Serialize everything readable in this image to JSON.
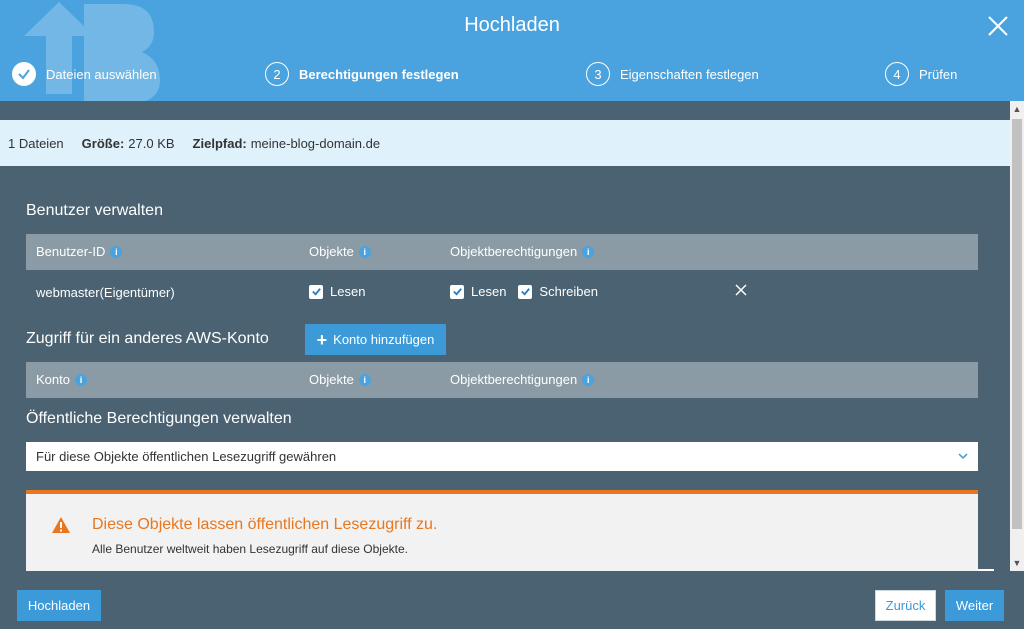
{
  "header": {
    "title": "Hochladen",
    "bg_color": "#4aa3de",
    "steps": [
      {
        "num": "",
        "label": "Dateien auswählen",
        "state": "done"
      },
      {
        "num": "2",
        "label": "Berechtigungen festlegen",
        "state": "active"
      },
      {
        "num": "3",
        "label": "Eigenschaften festlegen",
        "state": "pending"
      },
      {
        "num": "4",
        "label": "Prüfen",
        "state": "pending"
      }
    ]
  },
  "infobar": {
    "files": "1 Dateien",
    "size_label": "Größe:",
    "size_value": "27.0 KB",
    "target_label": "Zielpfad:",
    "target_value": "meine-blog-domain.de"
  },
  "users": {
    "title": "Benutzer verwalten",
    "headers": [
      "Benutzer-ID",
      "Objekte",
      "Objektberechtigungen"
    ],
    "row": {
      "user": "webmaster(Eigentümer)",
      "objects_read": "Lesen",
      "perm_read": "Lesen",
      "perm_write": "Schreiben"
    }
  },
  "aws": {
    "title": "Zugriff für ein anderes AWS-Konto",
    "add_button": "Konto hinzufügen",
    "headers": [
      "Konto",
      "Objekte",
      "Objektberechtigungen"
    ]
  },
  "public": {
    "title": "Öffentliche Berechtigungen verwalten",
    "select_value": "Für diese Objekte öffentlichen Lesezugriff gewähren"
  },
  "warning": {
    "title": "Diese Objekte lassen öffentlichen Lesezugriff zu.",
    "text": "Alle Benutzer weltweit haben Lesezugriff auf diese Objekte.",
    "color": "#e8771f"
  },
  "footer": {
    "upload": "Hochladen",
    "back": "Zurück",
    "next": "Weiter"
  }
}
